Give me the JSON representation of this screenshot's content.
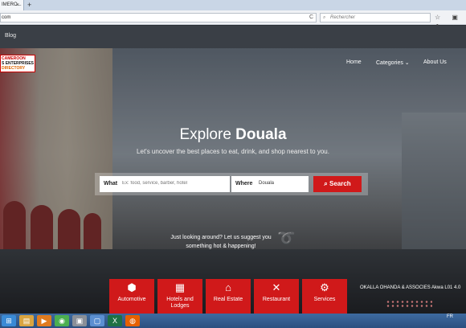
{
  "browser": {
    "tab_title": "IMERO...",
    "tab_close": "×",
    "new_tab": "+",
    "url": "com",
    "reload": "C",
    "search_placeholder": "Rechercher",
    "search_icon": "⌕",
    "toolbar_icons": "☆ ▣ ⬇ ⌂ ☰"
  },
  "site": {
    "topstrip": {
      "blog_label": "Blog"
    },
    "logo": {
      "line1": "CAMEROON",
      "line2": "S ENTERPRISES",
      "line3": "DIRECTORY"
    },
    "nav": {
      "home": "Home",
      "categories": "Categories ⌄",
      "about": "About Us"
    },
    "hero": {
      "title_plain": "Explore",
      "title_bold": "Douala",
      "subtitle": "Let's uncover the best places to eat, drink, and shop nearest to you."
    },
    "search": {
      "what_label": "What",
      "what_placeholder": "Ex: food, service, barber, hotel",
      "where_label": "Where",
      "where_value": "Douala",
      "button_label": "⌕ Search"
    },
    "suggest": {
      "line1": "Just looking around? Let us suggest you",
      "line2": "something hot & happening!"
    },
    "categories": [
      {
        "icon": "⬢",
        "label": "Automotive"
      },
      {
        "icon": "▦",
        "label": "Hotels and Lodges"
      },
      {
        "icon": "⌂",
        "label": "Real Estate"
      },
      {
        "icon": "✕",
        "label": "Restaurant"
      },
      {
        "icon": "⚙",
        "label": "Services"
      }
    ],
    "banner_text": "OKALLA OHANDA & ASSOCIES Akwa L01 4.0"
  },
  "taskbar": {
    "icons": [
      "⊞",
      "▤",
      "▶",
      "◉",
      "▣",
      "▢",
      "X",
      "◍"
    ],
    "language": "FR"
  },
  "colors": {
    "accent": "#d0191a",
    "strip": "#3a3f46",
    "taskbar": "#2b4f80"
  }
}
